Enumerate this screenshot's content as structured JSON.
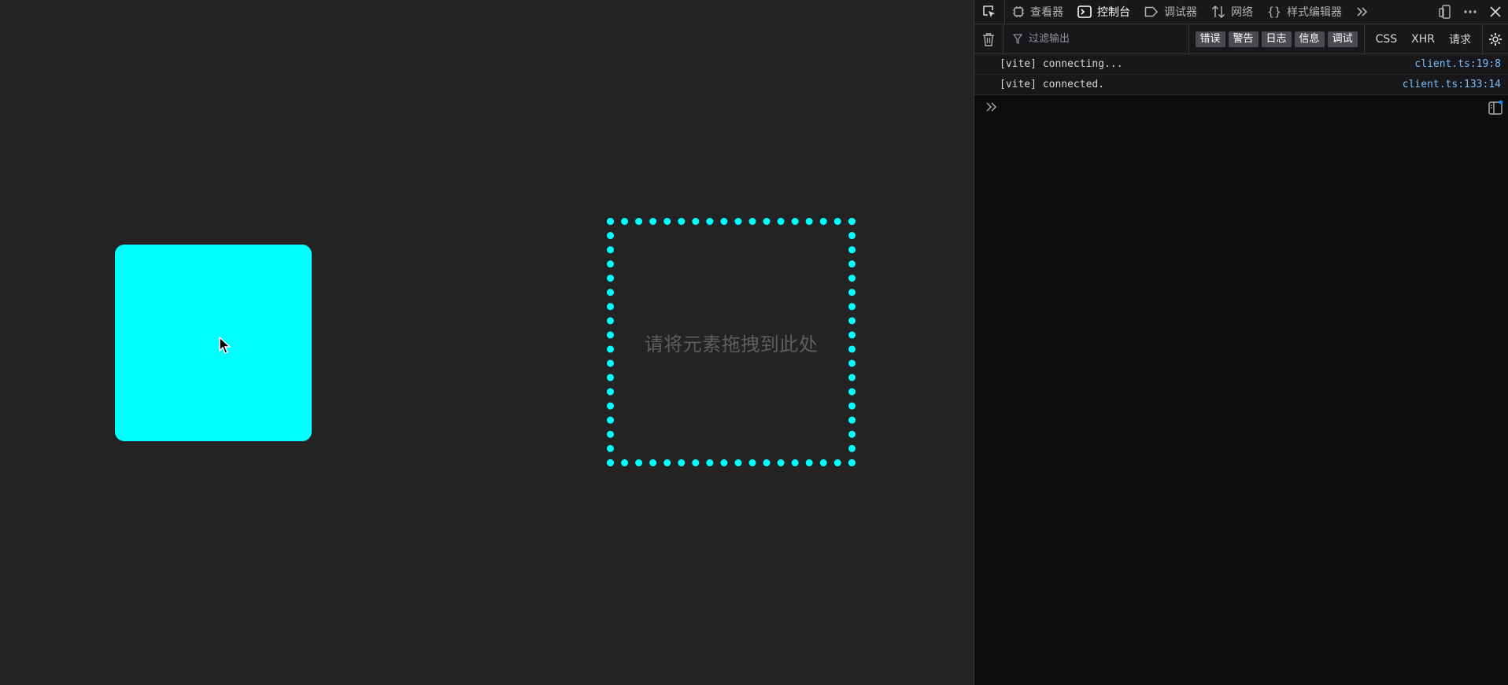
{
  "page": {
    "drop_zone_text": "请将元素拖拽到此处"
  },
  "devtools": {
    "tabs": [
      {
        "label": "查看器",
        "icon": "inspector-icon"
      },
      {
        "label": "控制台",
        "icon": "console-icon",
        "active": true
      },
      {
        "label": "调试器",
        "icon": "debugger-icon"
      },
      {
        "label": "网络",
        "icon": "network-icon"
      },
      {
        "label": "样式编辑器",
        "icon": "style-editor-icon"
      }
    ],
    "toolbar": {
      "filter_placeholder": "过滤输出",
      "levels": [
        "错误",
        "警告",
        "日志",
        "信息",
        "调试"
      ],
      "types": [
        "CSS",
        "XHR",
        "请求"
      ]
    },
    "logs": [
      {
        "message": "[vite] connecting...",
        "source": "client.ts:19:8"
      },
      {
        "message": "[vite] connected.",
        "source": "client.ts:133:14"
      }
    ]
  },
  "colors": {
    "accent": "#00ffff",
    "page_bg": "#232323",
    "devtools_bg": "#0c0c0d",
    "link": "#75bfff"
  }
}
